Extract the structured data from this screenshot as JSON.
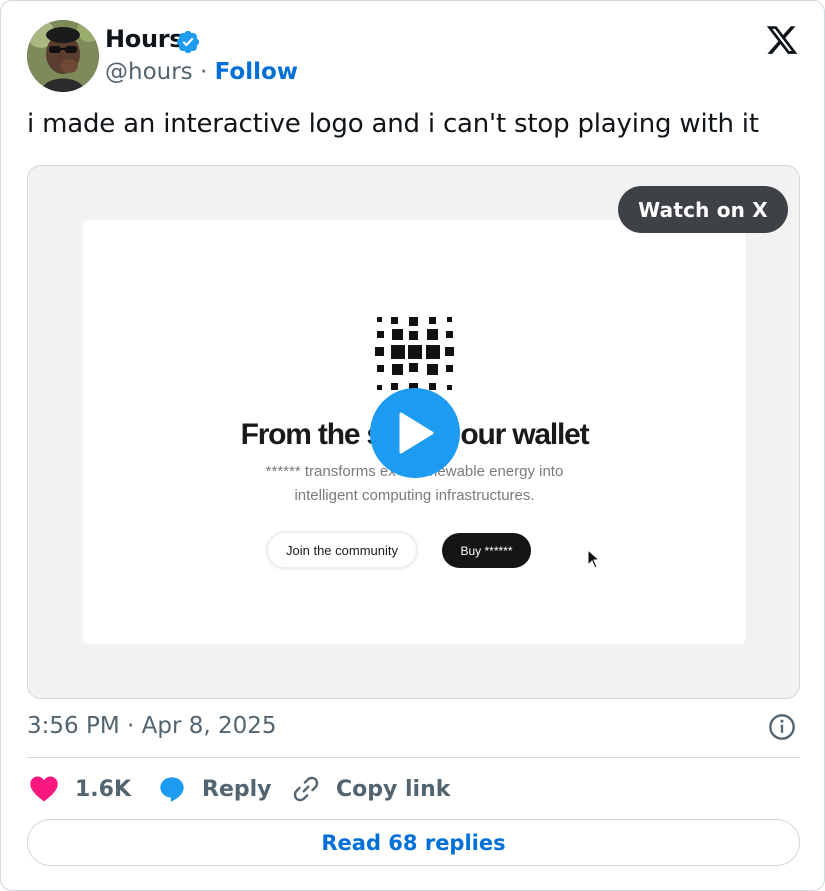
{
  "author": {
    "name": "Hours",
    "handle": "@hours",
    "separator": "·",
    "follow_label": "Follow"
  },
  "tweet": {
    "text": "i made an interactive logo and i can't stop playing with it"
  },
  "media": {
    "watch_label": "Watch on X",
    "screen": {
      "headline": "From the s           our wallet",
      "subline_1": "****** transforms ex        newable energy into",
      "subline_2": "intelligent computing infrastructures.",
      "join_label": "Join the community",
      "buy_label": "Buy ******"
    }
  },
  "meta": {
    "timestamp": "3:56 PM · Apr 8, 2025"
  },
  "actions": {
    "like_count": "1.6K",
    "reply_label": "Reply",
    "copy_label": "Copy link"
  },
  "read_replies_label": "Read 68 replies",
  "colors": {
    "accent": "#1d9bf0",
    "link": "#006fd6",
    "like": "#f91880",
    "muted": "#536471"
  },
  "icons": [
    "verified-badge-icon",
    "x-logo-icon",
    "play-icon",
    "cursor-icon",
    "info-icon",
    "heart-icon",
    "reply-bubble-icon",
    "link-icon"
  ]
}
